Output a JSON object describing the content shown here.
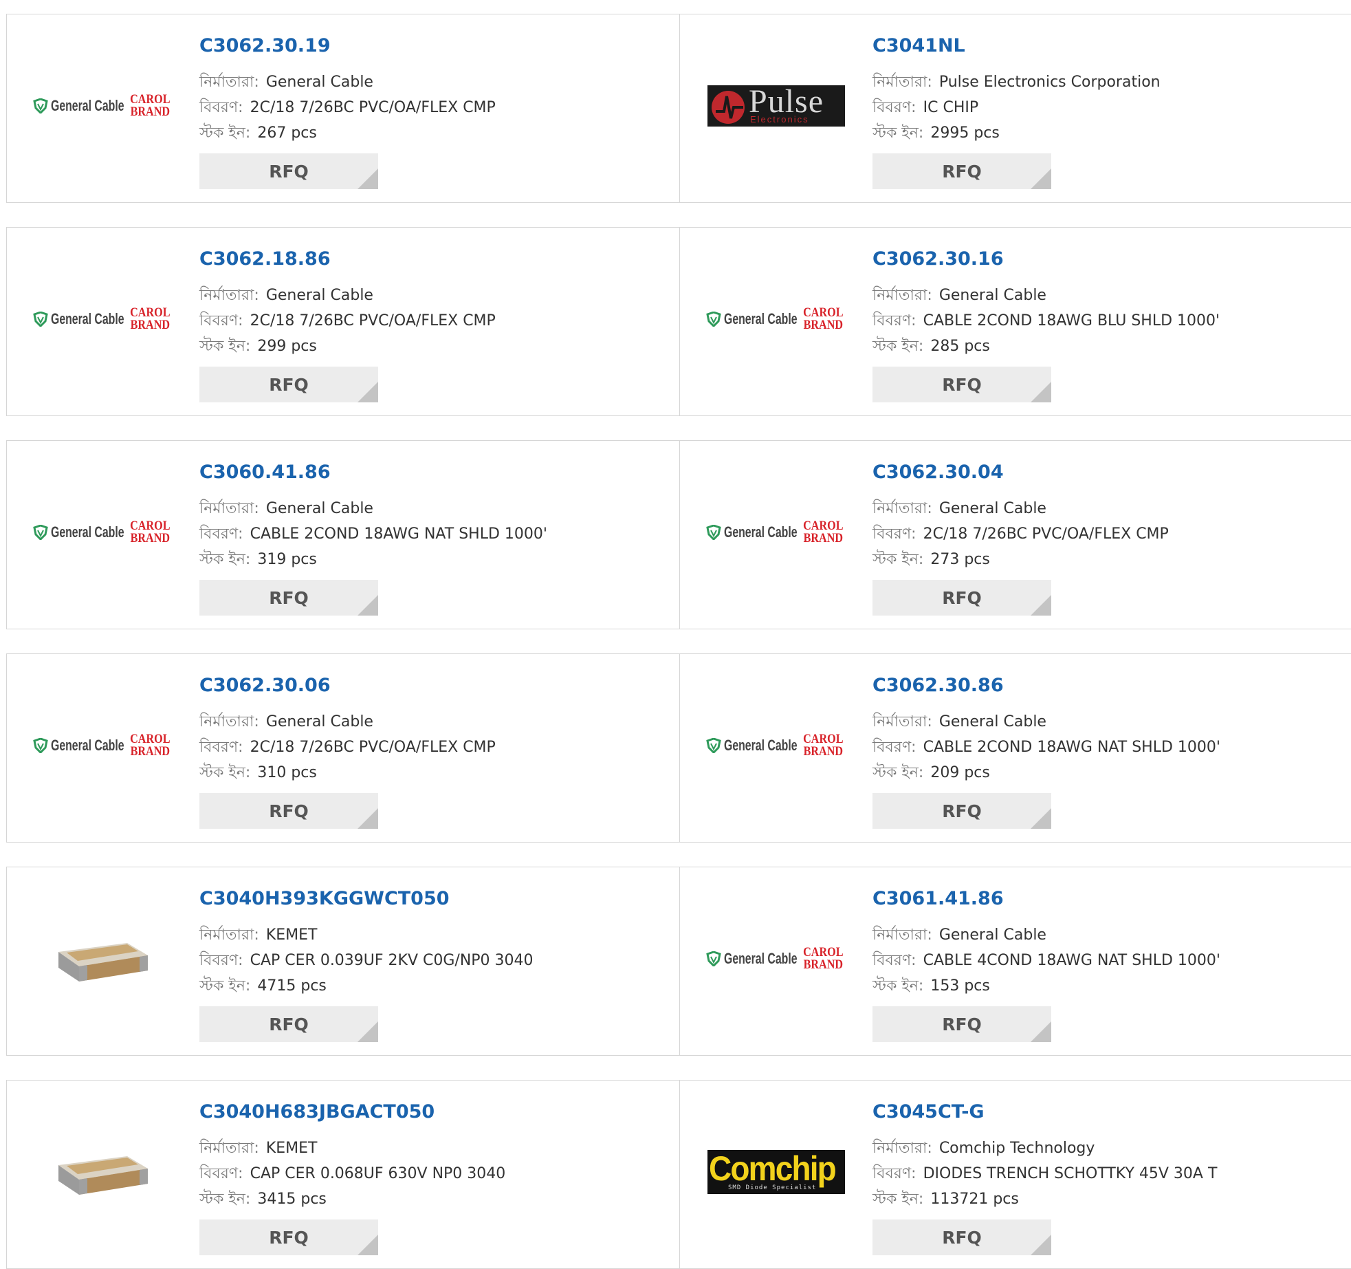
{
  "labels": {
    "manufacturer": "নির্মাতারা:",
    "description": "বিবরণ:",
    "stock": "স্টক ইন:",
    "rfq": "RFQ"
  },
  "logos": {
    "general_cable": "General Cable",
    "carol_line1": "CAROL",
    "carol_line2": "BRAND",
    "pulse_word": "Pulse",
    "pulse_sub": "Electronics",
    "comchip_word": "Comchip",
    "comchip_sub": "SMD Diode Specialist"
  },
  "products": [
    {
      "part": "C3062.30.19",
      "manufacturer": "General Cable",
      "description": "2C/18 7/26BC PVC/OA/FLEX CMP",
      "stock": "267 pcs",
      "logo": "general-cable-logo"
    },
    {
      "part": "C3041NL",
      "manufacturer": "Pulse Electronics Corporation",
      "description": "IC CHIP",
      "stock": "2995 pcs",
      "logo": "pulse-logo"
    },
    {
      "part": "C3062.18.86",
      "manufacturer": "General Cable",
      "description": "2C/18 7/26BC PVC/OA/FLEX CMP",
      "stock": "299 pcs",
      "logo": "general-cable-logo"
    },
    {
      "part": "C3062.30.16",
      "manufacturer": "General Cable",
      "description": "CABLE 2COND 18AWG BLU SHLD 1000'",
      "stock": "285 pcs",
      "logo": "general-cable-logo"
    },
    {
      "part": "C3060.41.86",
      "manufacturer": "General Cable",
      "description": "CABLE 2COND 18AWG NAT SHLD 1000'",
      "stock": "319 pcs",
      "logo": "general-cable-logo"
    },
    {
      "part": "C3062.30.04",
      "manufacturer": "General Cable",
      "description": "2C/18 7/26BC PVC/OA/FLEX CMP",
      "stock": "273 pcs",
      "logo": "general-cable-logo"
    },
    {
      "part": "C3062.30.06",
      "manufacturer": "General Cable",
      "description": "2C/18 7/26BC PVC/OA/FLEX CMP",
      "stock": "310 pcs",
      "logo": "general-cable-logo"
    },
    {
      "part": "C3062.30.86",
      "manufacturer": "General Cable",
      "description": "CABLE 2COND 18AWG NAT SHLD 1000'",
      "stock": "209 pcs",
      "logo": "general-cable-logo"
    },
    {
      "part": "C3040H393KGGWCT050",
      "manufacturer": "KEMET",
      "description": "CAP CER 0.039UF 2KV C0G/NP0 3040",
      "stock": "4715 pcs",
      "logo": "ceramic-capacitor-image"
    },
    {
      "part": "C3061.41.86",
      "manufacturer": "General Cable",
      "description": "CABLE 4COND 18AWG NAT SHLD 1000'",
      "stock": "153 pcs",
      "logo": "general-cable-logo"
    },
    {
      "part": "C3040H683JBGACT050",
      "manufacturer": "KEMET",
      "description": "CAP CER 0.068UF 630V NP0 3040",
      "stock": "3415 pcs",
      "logo": "ceramic-capacitor-image"
    },
    {
      "part": "C3045CT-G",
      "manufacturer": "Comchip Technology",
      "description": "DIODES TRENCH SCHOTTKY 45V 30A T",
      "stock": "113721 pcs",
      "logo": "comchip-logo"
    }
  ],
  "colors": {
    "part_link": "#1a63ad",
    "label": "#7a7a7a",
    "rfq_bg": "#ececec",
    "border": "#d6d6d6",
    "carol_red": "#d8232a",
    "gc_green": "#2e9a5a",
    "comchip_yellow": "#f2d21c"
  }
}
